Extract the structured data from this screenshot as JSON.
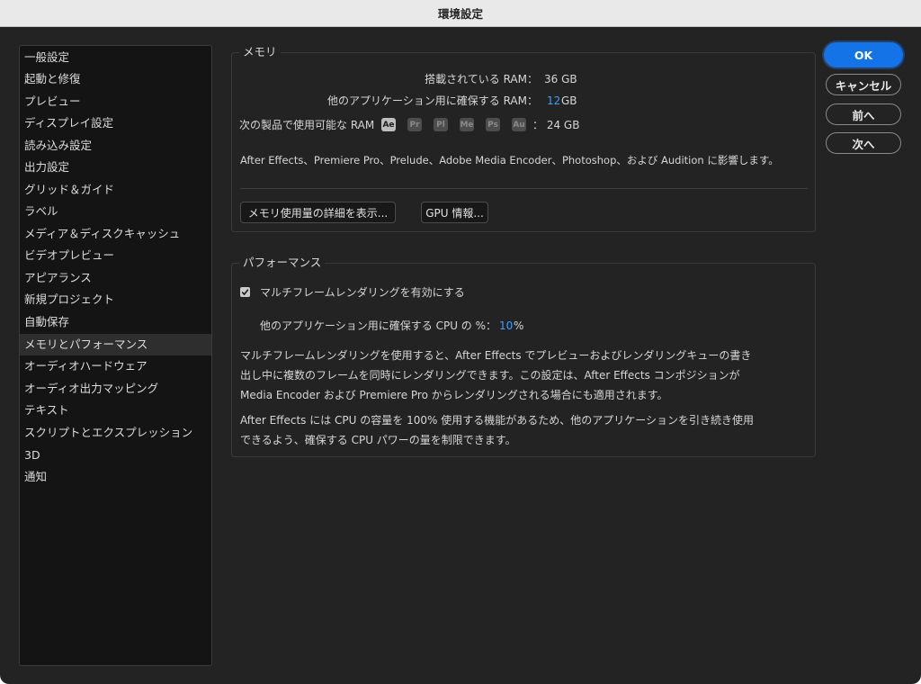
{
  "window": {
    "title": "環境設定"
  },
  "sidebar": {
    "items": [
      {
        "label": "一般設定"
      },
      {
        "label": "起動と修復"
      },
      {
        "label": "プレビュー"
      },
      {
        "label": "ディスプレイ設定"
      },
      {
        "label": "読み込み設定"
      },
      {
        "label": "出力設定"
      },
      {
        "label": "グリッド＆ガイド"
      },
      {
        "label": "ラベル"
      },
      {
        "label": "メディア＆ディスクキャッシュ"
      },
      {
        "label": "ビデオプレビュー"
      },
      {
        "label": "アピアランス"
      },
      {
        "label": "新規プロジェクト"
      },
      {
        "label": "自動保存"
      },
      {
        "label": "メモリとパフォーマンス",
        "selected": true
      },
      {
        "label": "オーディオハードウェア"
      },
      {
        "label": "オーディオ出力マッピング"
      },
      {
        "label": "テキスト"
      },
      {
        "label": "スクリプトとエクスプレッション"
      },
      {
        "label": "3D"
      },
      {
        "label": "通知"
      }
    ]
  },
  "memory": {
    "title": "メモリ",
    "installed_label": "搭載されている RAM：",
    "installed_value": "36 GB",
    "reserved_label": "他のアプリケーション用に確保する RAM：",
    "reserved_value": "12",
    "reserved_unit": "GB",
    "available_label": "次の製品で使用可能な RAM",
    "apps": [
      "Ae",
      "Pr",
      "Pl",
      "Me",
      "Ps",
      "Au"
    ],
    "available_value": "：  24 GB",
    "shared_note": "After Effects、Premiere Pro、Prelude、Adobe Media Encoder、Photoshop、および Audition に影響します。",
    "details_button": "メモリ使用量の詳細を表示...",
    "gpu_button": "GPU 情報..."
  },
  "performance": {
    "title": "パフォーマンス",
    "mfr_checkbox_label": "マルチフレームレンダリングを有効にする",
    "mfr_checked": true,
    "cpu_label": "他のアプリケーション用に確保する CPU の %：",
    "cpu_value": "10",
    "cpu_unit": "%",
    "para1": [
      "マルチフレームレンダリングを使用すると、After Effects でプレビューおよびレンダリングキューの書き",
      "出し中に複数のフレームを同時にレンダリングできます。この設定は、After Effects コンポジションが",
      "Media Encoder および Premiere Pro からレンダリングされる場合にも適用されます。"
    ],
    "para2": [
      "After Effects には CPU の容量を 100% 使用する機能があるため、他のアプリケーションを引き続き使用",
      "できるよう、確保する CPU パワーの量を制限できます。"
    ]
  },
  "dialog_buttons": {
    "ok": "OK",
    "cancel": "キャンセル",
    "prev": "前へ",
    "next": "次へ"
  },
  "colors": {
    "accent": "#1473e6",
    "value_blue": "#3d9eff",
    "background": "#232323"
  }
}
